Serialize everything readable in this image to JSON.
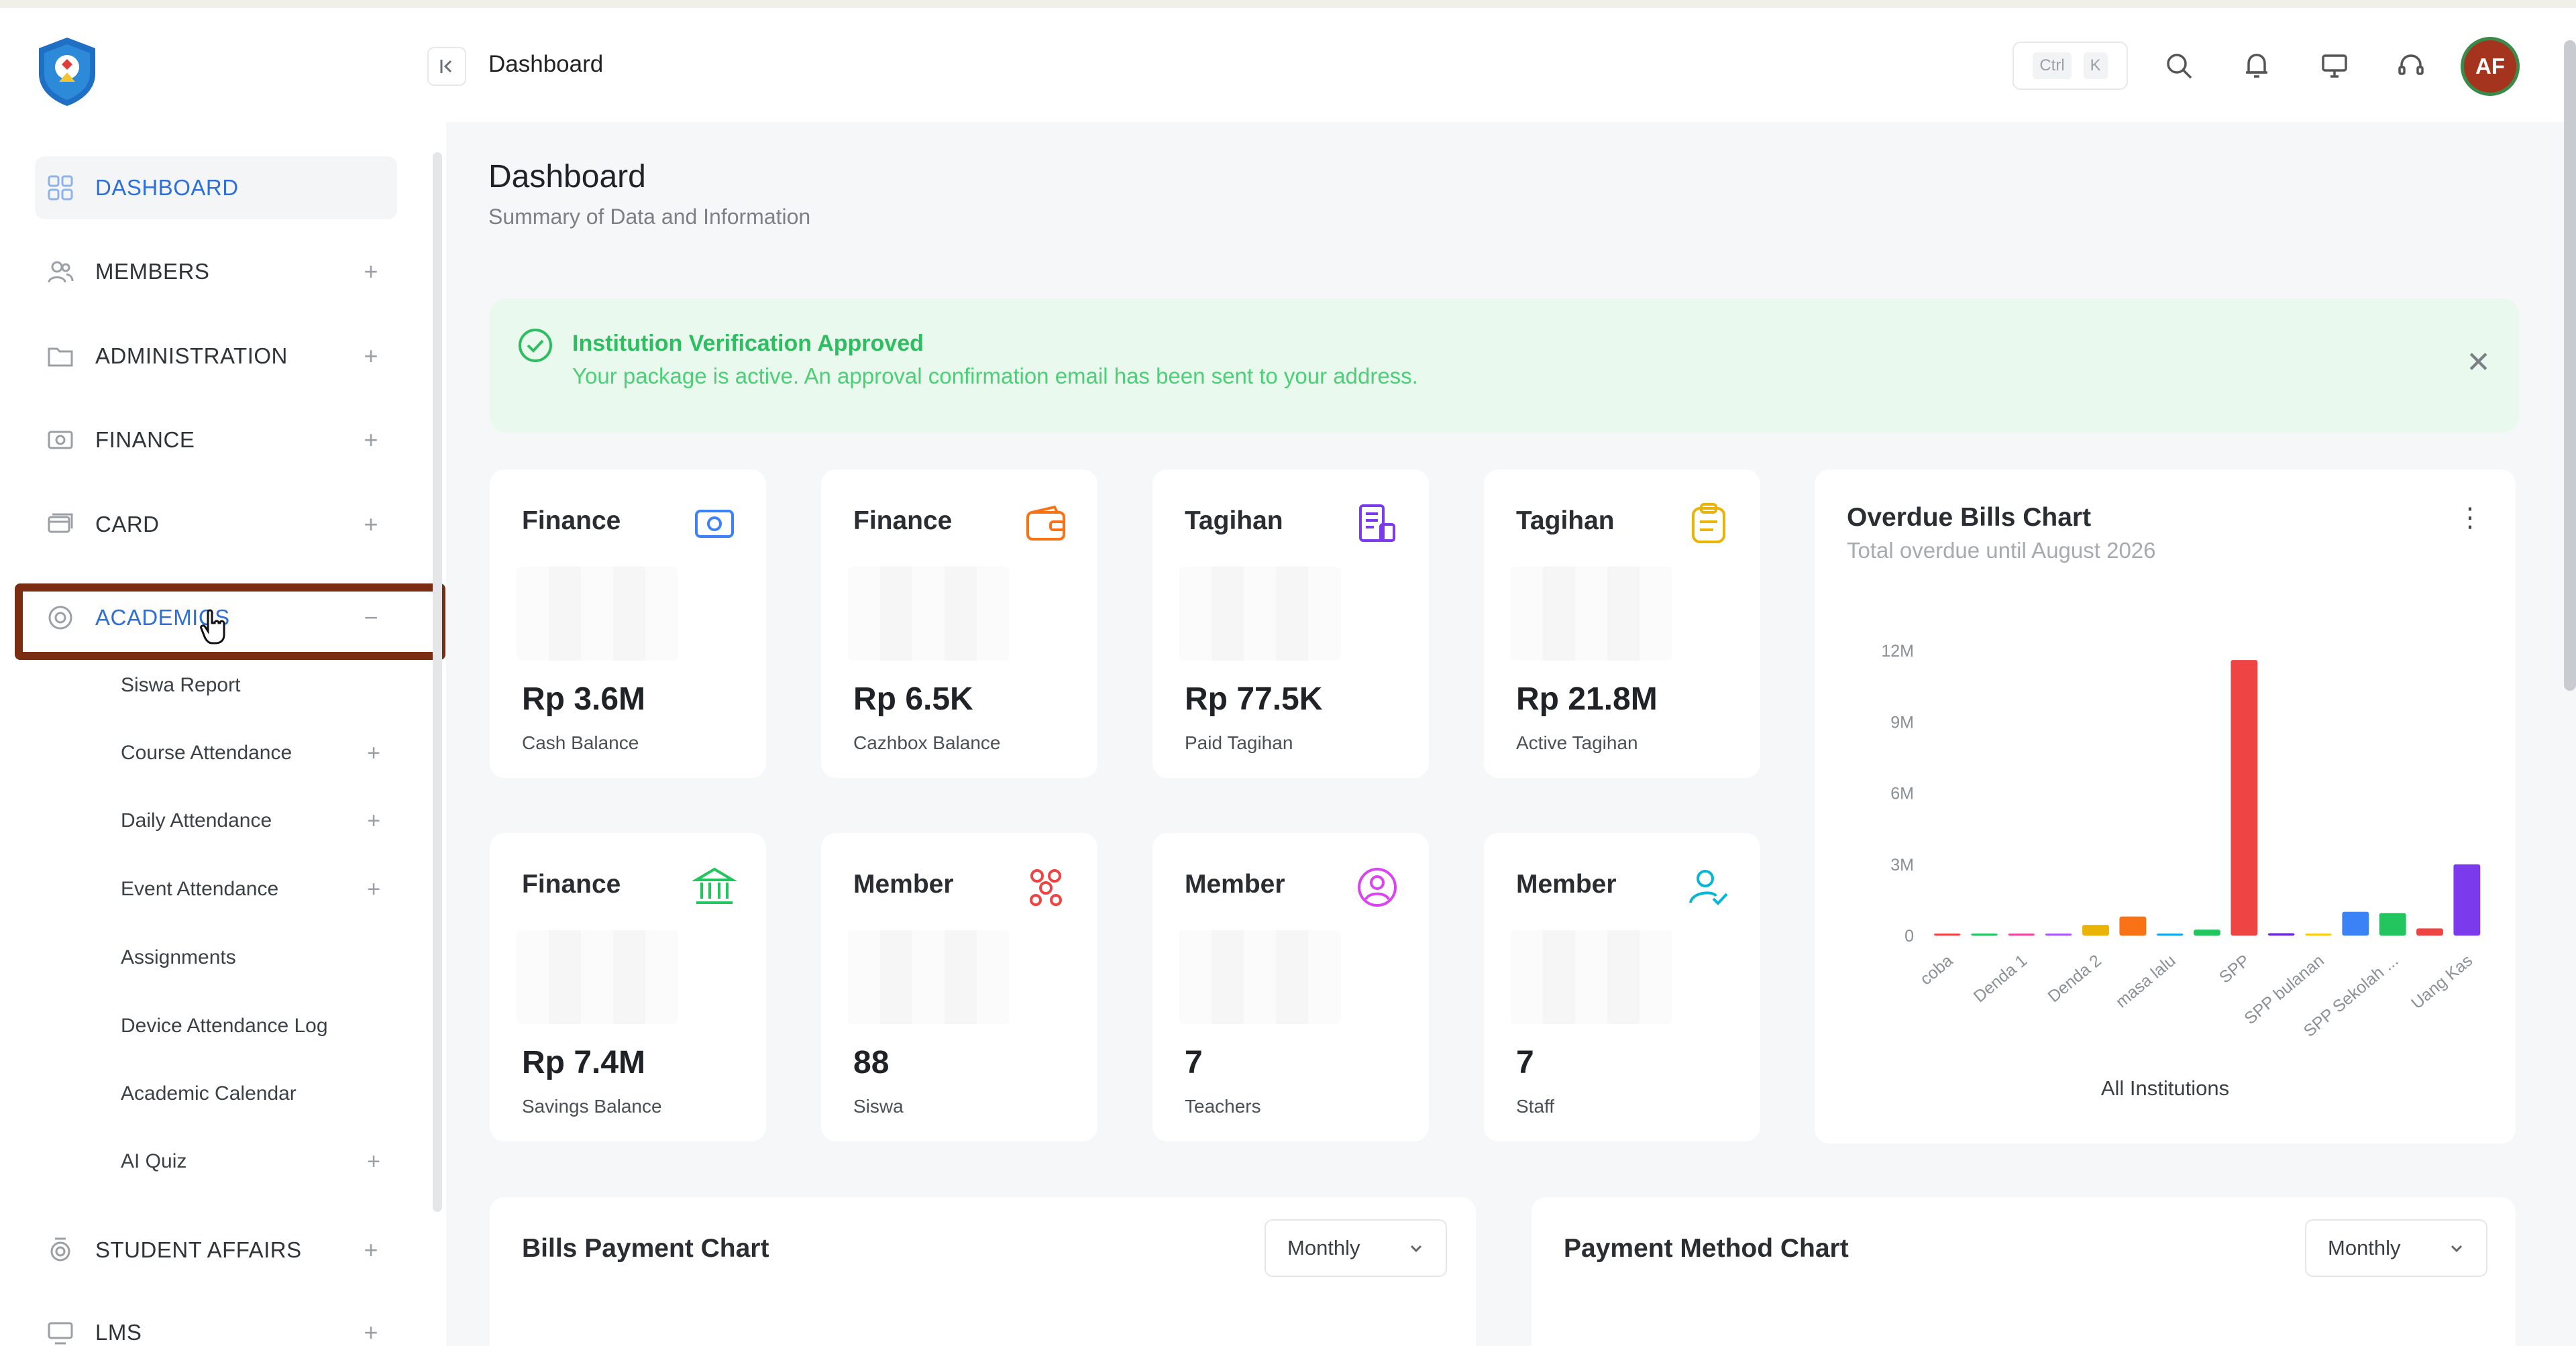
{
  "header": {
    "breadcrumb": "Dashboard",
    "shortcut_keys": [
      "Ctrl",
      "K"
    ],
    "avatar_initials": "AF",
    "page_title": "Dashboard",
    "page_subtitle": "Summary of Data and Information"
  },
  "sidebar": {
    "items": [
      {
        "label": "DASHBOARD",
        "icon": "grid-icon",
        "toggle": ""
      },
      {
        "label": "MEMBERS",
        "icon": "users-icon",
        "toggle": "+"
      },
      {
        "label": "ADMINISTRATION",
        "icon": "folder-icon",
        "toggle": "+"
      },
      {
        "label": "FINANCE",
        "icon": "money-icon",
        "toggle": "+"
      },
      {
        "label": "CARD",
        "icon": "card-icon",
        "toggle": "+"
      },
      {
        "label": "ACADEMICS",
        "icon": "academic-icon",
        "toggle": "−"
      },
      {
        "label": "STUDENT AFFAIRS",
        "icon": "medal-icon",
        "toggle": "+"
      },
      {
        "label": "LMS",
        "icon": "lms-icon",
        "toggle": "+"
      }
    ],
    "academics_sub": [
      {
        "label": "Siswa Report",
        "toggle": ""
      },
      {
        "label": "Course Attendance",
        "toggle": "+"
      },
      {
        "label": "Daily Attendance",
        "toggle": "+"
      },
      {
        "label": "Event Attendance",
        "toggle": "+"
      },
      {
        "label": "Assignments",
        "toggle": ""
      },
      {
        "label": "Device Attendance Log",
        "toggle": ""
      },
      {
        "label": "Academic Calendar",
        "toggle": ""
      },
      {
        "label": "AI Quiz",
        "toggle": "+"
      }
    ]
  },
  "alert": {
    "title": "Institution Verification Approved",
    "message": "Your package is active. An approval confirmation email has been sent to your address."
  },
  "stats": [
    {
      "title": "Finance",
      "value": "Rp 3.6M",
      "label": "Cash Balance",
      "icon": "cash-icon",
      "color": "#3b82f6"
    },
    {
      "title": "Finance",
      "value": "Rp 6.5K",
      "label": "Cazhbox Balance",
      "icon": "wallet-icon",
      "color": "#f97316"
    },
    {
      "title": "Tagihan",
      "value": "Rp 77.5K",
      "label": "Paid Tagihan",
      "icon": "receipt-icon",
      "color": "#7c3aed"
    },
    {
      "title": "Tagihan",
      "value": "Rp 21.8M",
      "label": "Active Tagihan",
      "icon": "clipboard-icon",
      "color": "#eab308"
    },
    {
      "title": "Finance",
      "value": "Rp 7.4M",
      "label": "Savings Balance",
      "icon": "bank-icon",
      "color": "#22c55e"
    },
    {
      "title": "Member",
      "value": "88",
      "label": "Siswa",
      "icon": "group-icon",
      "color": "#ef4444"
    },
    {
      "title": "Member",
      "value": "7",
      "label": "Teachers",
      "icon": "user-circle-icon",
      "color": "#d946ef"
    },
    {
      "title": "Member",
      "value": "7",
      "label": "Staff",
      "icon": "user-check-icon",
      "color": "#06b6d4"
    }
  ],
  "overdue_chart": {
    "title": "Overdue Bills Chart",
    "subtitle": "Total overdue until August 2026",
    "caption": "All Institutions"
  },
  "chart_data": {
    "type": "bar",
    "title": "Overdue Bills Chart",
    "subtitle": "Total overdue until August 2026",
    "xlabel": "All Institutions",
    "ylabel": "",
    "ylim": [
      0,
      12000000
    ],
    "yticks": [
      "0",
      "3M",
      "6M",
      "9M",
      "12M"
    ],
    "ytick_values": [
      0,
      3000000,
      6000000,
      9000000,
      12000000
    ],
    "categories": [
      "coba",
      "",
      "Denda 1",
      "",
      "Denda 2",
      "",
      "masa lalu",
      "",
      "SPP",
      "",
      "SPP bulanan",
      "",
      "SPP Sekolah ...",
      "",
      "Uang Kas"
    ],
    "tick_labels": [
      "coba",
      "Denda 1",
      "Denda 2",
      "masa lalu",
      "SPP",
      "SPP bulanan",
      "SPP Sekolah ...",
      "Uang Kas"
    ],
    "values": [
      20000,
      50000,
      40000,
      40000,
      450000,
      800000,
      50000,
      250000,
      11600000,
      100000,
      40000,
      1000000,
      950000,
      300000,
      3000000
    ],
    "colors": [
      "#ef4444",
      "#22c55e",
      "#ec4899",
      "#a855f7",
      "#eab308",
      "#f97316",
      "#0ea5e9",
      "#22c55e",
      "#ef4444",
      "#6d28d9",
      "#facc15",
      "#3b82f6",
      "#22c55e",
      "#ef4444",
      "#7c3aed"
    ]
  },
  "bottom_cards": [
    {
      "title": "Bills Payment Chart",
      "select": "Monthly"
    },
    {
      "title": "Payment Method Chart",
      "select": "Monthly"
    }
  ]
}
